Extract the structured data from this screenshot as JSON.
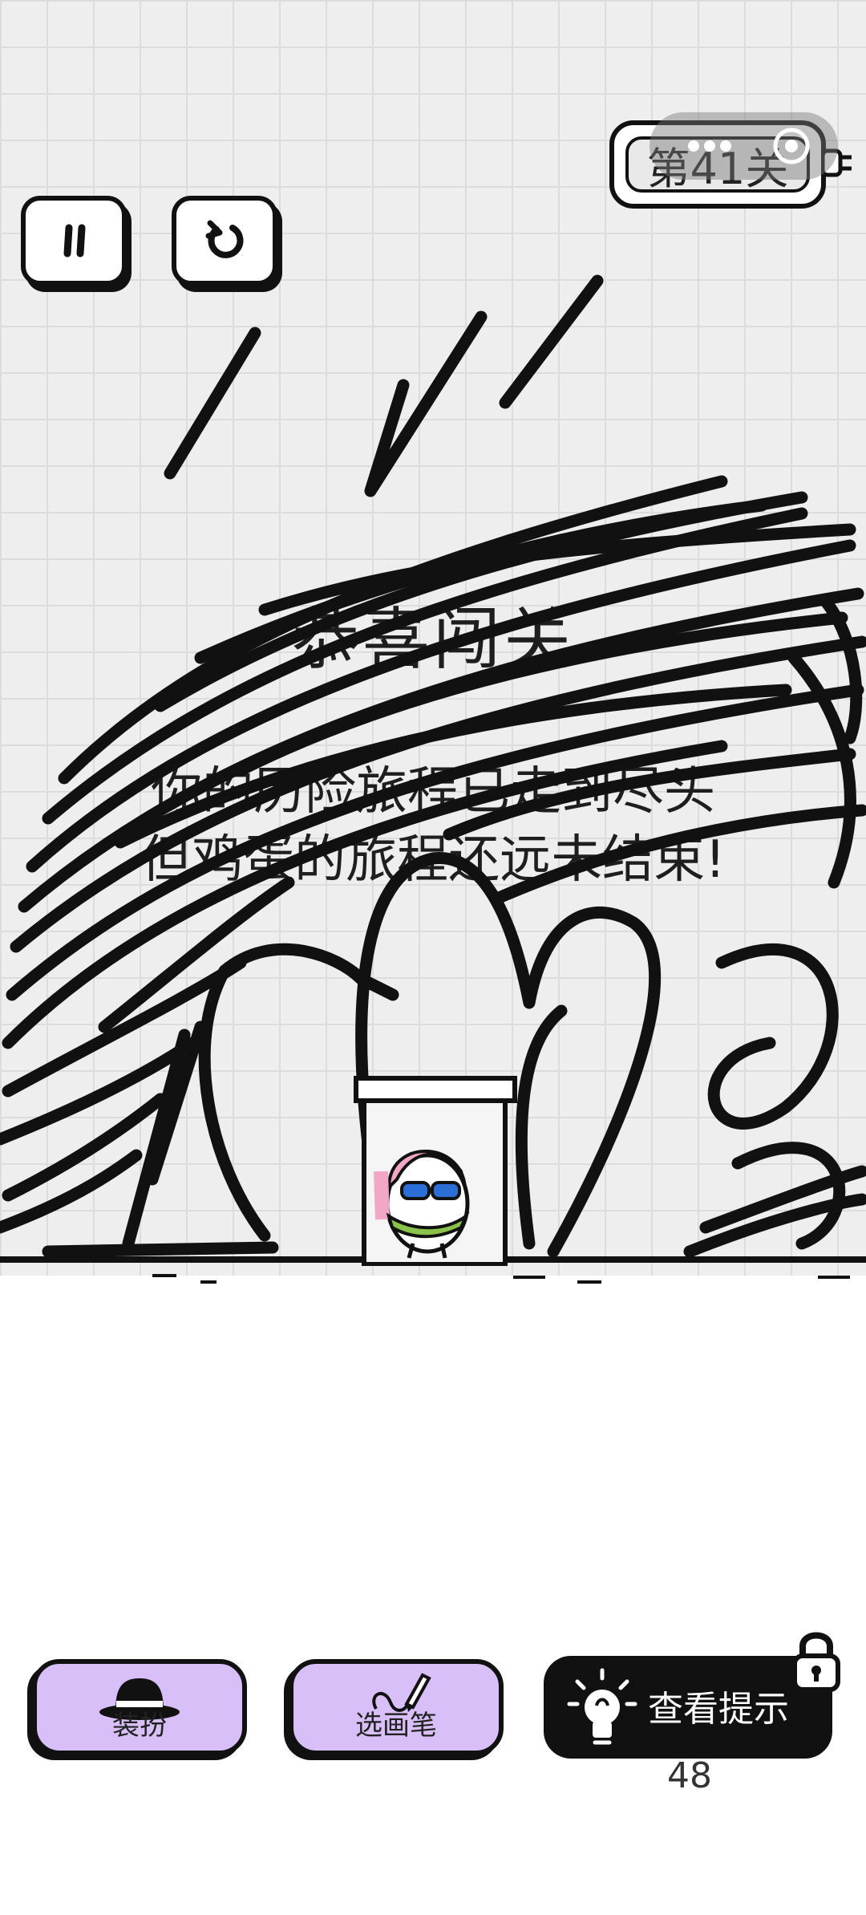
{
  "hud": {
    "level_label": "第41关",
    "pause_icon": "pause-icon",
    "restart_icon": "restart-icon"
  },
  "overlay": {
    "title": "恭喜闯关",
    "line1": "你的历险旅程已走到尽头",
    "line2": "但鸡蛋的旅程还远未结束!"
  },
  "toolbar": {
    "dressup_label": "装扮",
    "dressup_icon": "hat-icon",
    "pen_label": "选画笔",
    "pen_icon": "pencil-icon",
    "hint_label": "查看提示",
    "hint_icon": "lightbulb-icon",
    "hint_lock_icon": "lock-icon",
    "hint_count": "48"
  },
  "colors": {
    "grid_background": "#eeeeee",
    "toolbar_button": "#d9bff7",
    "hint_button": "#111111",
    "ink": "#111111"
  }
}
